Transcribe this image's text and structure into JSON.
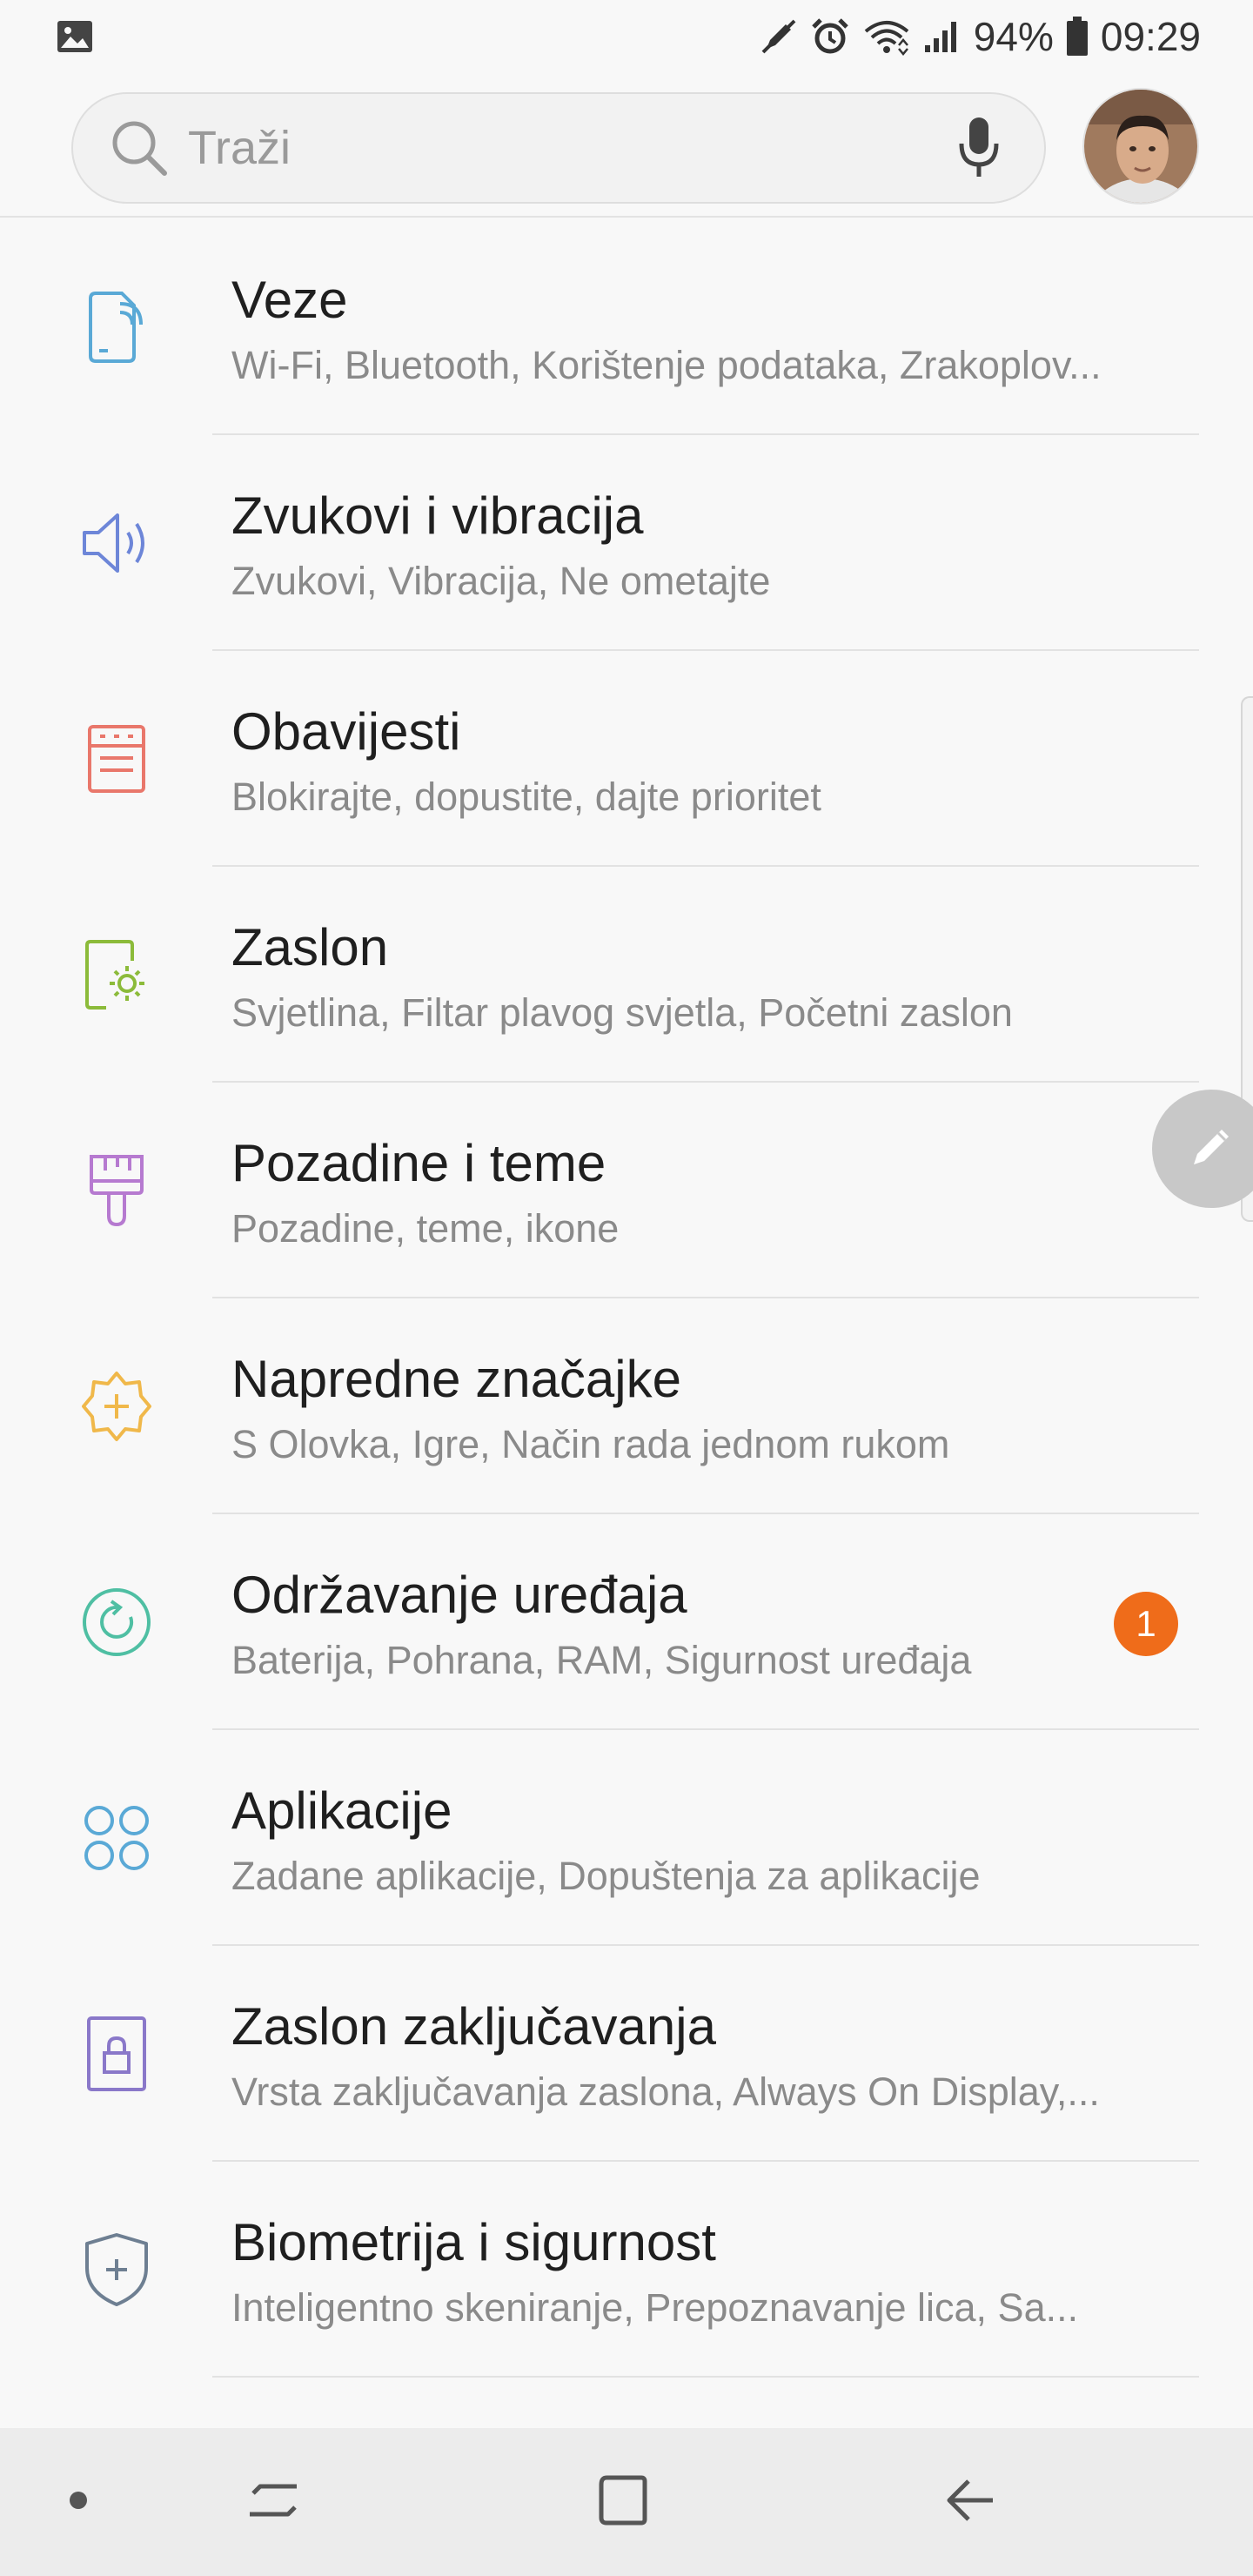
{
  "status_bar": {
    "battery_percent": "94%",
    "time": "09:29",
    "icons": [
      "image-icon",
      "nfc-pen-icon",
      "alarm-icon",
      "wifi-icon",
      "signal-icon",
      "battery-icon"
    ]
  },
  "search": {
    "placeholder": "Traži",
    "value": ""
  },
  "settings": [
    {
      "title": "Veze",
      "subtitle": "Wi-Fi, Bluetooth, Korištenje podataka, Zrakoplov...",
      "icon": "connections-icon",
      "color": "#5aa9d6"
    },
    {
      "title": "Zvukovi i vibracija",
      "subtitle": "Zvukovi, Vibracija, Ne ometajte",
      "icon": "speaker-icon",
      "color": "#6d86d8"
    },
    {
      "title": "Obavijesti",
      "subtitle": "Blokirajte, dopustite, dajte prioritet",
      "icon": "notifications-icon",
      "color": "#e9776b"
    },
    {
      "title": "Zaslon",
      "subtitle": "Svjetlina, Filtar plavog svjetla, Početni zaslon",
      "icon": "display-icon",
      "color": "#8cbb3a"
    },
    {
      "title": "Pozadine i teme",
      "subtitle": "Pozadine, teme, ikone",
      "icon": "paintbrush-icon",
      "color": "#b67ad0"
    },
    {
      "title": "Napredne značajke",
      "subtitle": "S Olovka, Igre, Način rada jednom rukom",
      "icon": "advanced-gear-icon",
      "color": "#f0b84a"
    },
    {
      "title": "Održavanje uređaja",
      "subtitle": "Baterija, Pohrana, RAM, Sigurnost uređaja",
      "icon": "device-care-icon",
      "color": "#4fbfa3",
      "badge": "1"
    },
    {
      "title": "Aplikacije",
      "subtitle": "Zadane aplikacije, Dopuštenja za aplikacije",
      "icon": "apps-icon",
      "color": "#5aa9d6"
    },
    {
      "title": "Zaslon zaključavanja",
      "subtitle": "Vrsta zaključavanja zaslona, Always On Display,...",
      "icon": "lock-icon",
      "color": "#8a78c9"
    },
    {
      "title": "Biometrija i sigurnost",
      "subtitle": "Inteligentno skeniranje, Prepoznavanje lica, Sa...",
      "icon": "shield-icon",
      "color": "#6e7f92"
    }
  ],
  "colors": {
    "background": "#f8f8f8",
    "badge": "#ef6c1a",
    "divider": "#e2e2e2",
    "subtitle": "#8a8a8a"
  },
  "nav_bar": {
    "buttons": [
      "dot-icon",
      "recents-icon",
      "home-icon",
      "back-icon"
    ]
  }
}
